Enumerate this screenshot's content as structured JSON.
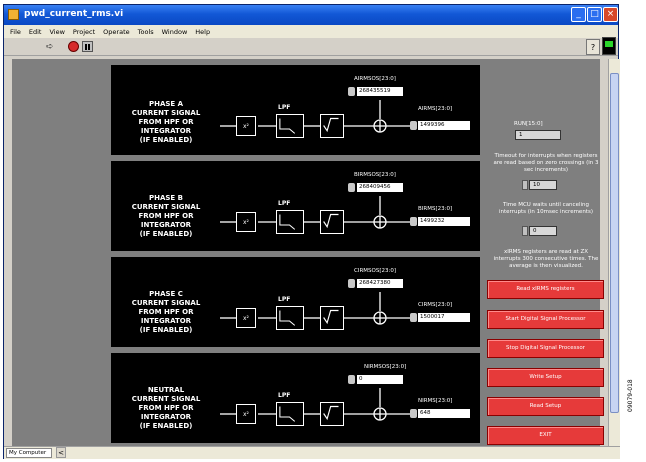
{
  "window": {
    "title": "pwd_current_rms.vi",
    "menu": [
      "File",
      "Edit",
      "View",
      "Project",
      "Operate",
      "Tools",
      "Window",
      "Help"
    ],
    "status_cell": "My Computer",
    "scroll_left_arrow": "<"
  },
  "blocks": [
    {
      "label": "PHASE A\nCURRENT SIGNAL\nFROM HPF OR\nINTEGRATOR\n(IF ENABLED)",
      "offset_reg": "AIRMSOS[23:0]",
      "offset_val": "268435519",
      "out_reg": "AIRMS[23:0]",
      "out_val": "1499396"
    },
    {
      "label": "PHASE B\nCURRENT SIGNAL\nFROM HPF OR\nINTEGRATOR\n(IF ENABLED)",
      "offset_reg": "BIRMSOS[23:0]",
      "offset_val": "268409456",
      "out_reg": "BIRMS[23:0]",
      "out_val": "1499232"
    },
    {
      "label": "PHASE C\nCURRENT SIGNAL\nFROM HPF OR\nINTEGRATOR\n(IF ENABLED)",
      "offset_reg": "CIRMSOS[23:0]",
      "offset_val": "268427380",
      "out_reg": "CIRMS[23:0]",
      "out_val": "1500017"
    },
    {
      "label": "NEUTRAL\nCURRENT SIGNAL\nFROM HPF OR\nINTEGRATOR\n(IF ENABLED)",
      "offset_reg": "NIRMSOS[23:0]",
      "offset_val": "0",
      "out_reg": "NIRMS[23:0]",
      "out_val": "648"
    }
  ],
  "diagram": {
    "lpf_label": "LPF",
    "sqrt_symbol": "√"
  },
  "controls": {
    "run_label": "RUN[15:0]",
    "run_value": "1",
    "timeout_label": "Timeout for interrupts when registers are read based on zero crossings (in 3 sec increments)",
    "timeout_value": "10",
    "wait_label": "Time MCU waits until canceling interrupts (in 10msec increments)",
    "wait_value": "0",
    "note": "xIRMS registers are read at ZX interrupts 300 consecutive times. The average is then visualized."
  },
  "buttons": [
    "Read xIRMS registers",
    "Start Digital Signal Processor",
    "Stop Digital Signal Processor",
    "Write Setup",
    "Read Setup",
    "EXIT"
  ],
  "figure_id": "09079-018"
}
